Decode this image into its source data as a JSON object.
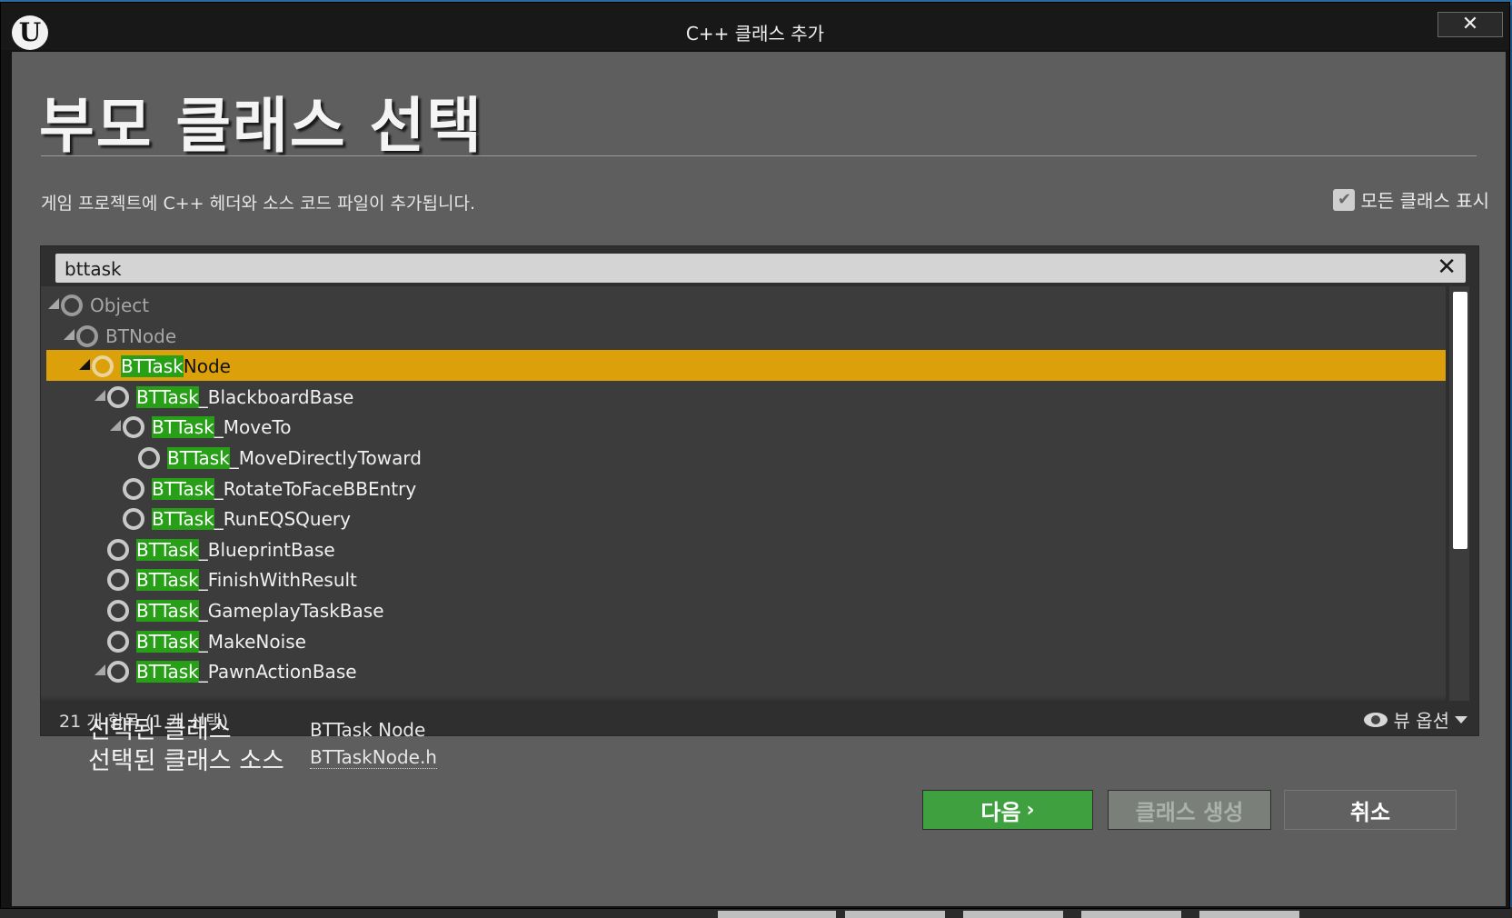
{
  "window": {
    "title": "C++ 클래스 추가",
    "logo_text": "U",
    "close_glyph": "✕"
  },
  "page": {
    "heading": "부모 클래스 선택",
    "description": "게임 프로젝트에 C++ 헤더와 소스 코드 파일이 추가됩니다.",
    "show_all_checked": true,
    "show_all_label": "모든 클래스 표시"
  },
  "search": {
    "value": "bttask",
    "clear_glyph": "✕"
  },
  "tree": [
    {
      "prefix": "",
      "rest": "Object",
      "expandable": true,
      "selected": false,
      "dim": true
    },
    {
      "prefix": "",
      "rest": "BTNode",
      "expandable": true,
      "selected": false,
      "dim": true
    },
    {
      "prefix": "BTTask",
      "rest": "Node",
      "expandable": true,
      "selected": true,
      "dim": false
    },
    {
      "prefix": "BTTask",
      "rest": "_BlackboardBase",
      "expandable": true,
      "selected": false,
      "dim": false
    },
    {
      "prefix": "BTTask",
      "rest": "_MoveTo",
      "expandable": true,
      "selected": false,
      "dim": false
    },
    {
      "prefix": "BTTask",
      "rest": "_MoveDirectlyToward",
      "expandable": false,
      "selected": false,
      "dim": false
    },
    {
      "prefix": "BTTask",
      "rest": "_RotateToFaceBBEntry",
      "expandable": false,
      "selected": false,
      "dim": false
    },
    {
      "prefix": "BTTask",
      "rest": "_RunEQSQuery",
      "expandable": false,
      "selected": false,
      "dim": false
    },
    {
      "prefix": "BTTask",
      "rest": "_BlueprintBase",
      "expandable": false,
      "selected": false,
      "dim": false
    },
    {
      "prefix": "BTTask",
      "rest": "_FinishWithResult",
      "expandable": false,
      "selected": false,
      "dim": false
    },
    {
      "prefix": "BTTask",
      "rest": "_GameplayTaskBase",
      "expandable": false,
      "selected": false,
      "dim": false
    },
    {
      "prefix": "BTTask",
      "rest": "_MakeNoise",
      "expandable": false,
      "selected": false,
      "dim": false
    },
    {
      "prefix": "BTTask",
      "rest": "_PawnActionBase",
      "expandable": true,
      "selected": false,
      "dim": false
    }
  ],
  "status": {
    "count_text": "21 개 항목 (1 개 선택)",
    "view_options_label": "뷰 옵션"
  },
  "selection": {
    "class_label": "선택된 클래스",
    "class_value": "BTTask Node",
    "source_label": "선택된 클래스 소스",
    "source_value": "BTTaskNode.h"
  },
  "buttons": {
    "next_label": "다음",
    "next_glyph": "›",
    "create_label": "클래스 생성",
    "cancel_label": "취소"
  },
  "icons": {
    "logo": "unreal-logo-icon",
    "close": "close-icon",
    "clear": "clear-search-icon",
    "checkbox": "checkmark-icon",
    "view": "eye-icon",
    "dropdown": "caret-down-icon",
    "tree_node": "class-circle-icon",
    "tree_expand": "expand-arrow-icon"
  },
  "colors": {
    "highlight_match": "#27a017",
    "selected_row": "#dca10a",
    "next_button": "#3fa03f",
    "panel_background": "#5e5e5e"
  }
}
